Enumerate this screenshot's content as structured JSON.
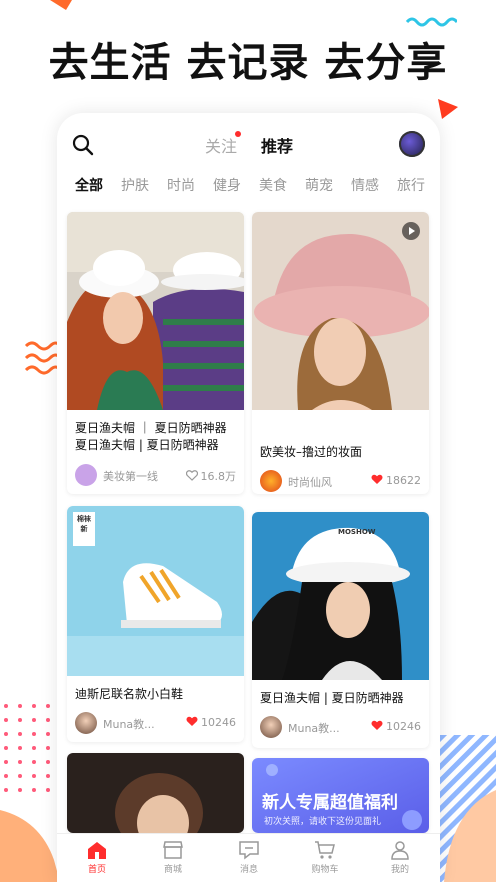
{
  "headline": "去生活 去记录 去分享",
  "colors": {
    "accent": "#ff2d2d",
    "deco_orange": "#ff6a2b",
    "deco_teal": "#2ec5e6"
  },
  "top_tabs": {
    "follow": "关注",
    "recommend": "推荐"
  },
  "categories": [
    "全部",
    "护肤",
    "时尚",
    "健身",
    "美食",
    "萌宠",
    "情感",
    "旅行"
  ],
  "feed": {
    "cards": [
      {
        "title": "夏日渔夫帽 ｜ 夏日防晒神器夏日渔夫帽 | 夏日防晒神器",
        "user": "美妆第一线",
        "likes": "16.8万",
        "liked": false
      },
      {
        "title": "欧美妆–撸过的妆面",
        "user": "时尚仙风",
        "likes": "18622",
        "liked": true,
        "is_video": true
      },
      {
        "title": "迪斯尼联名款小白鞋",
        "user": "Muna教...",
        "likes": "10246",
        "liked": true,
        "img_text": "棉袜新"
      },
      {
        "title": "夏日渔夫帽 | 夏日防晒神器",
        "user": "Muna教...",
        "likes": "10246",
        "liked": true,
        "img_text": "MOSHOW"
      },
      {
        "title": "",
        "user": "",
        "likes": ""
      },
      {
        "banner_title": "新人专属超值福利",
        "banner_sub": "初次关照，请收下这份见面礼"
      }
    ]
  },
  "bottom_nav": [
    "首页",
    "商城",
    "消息",
    "购物车",
    "我的"
  ]
}
